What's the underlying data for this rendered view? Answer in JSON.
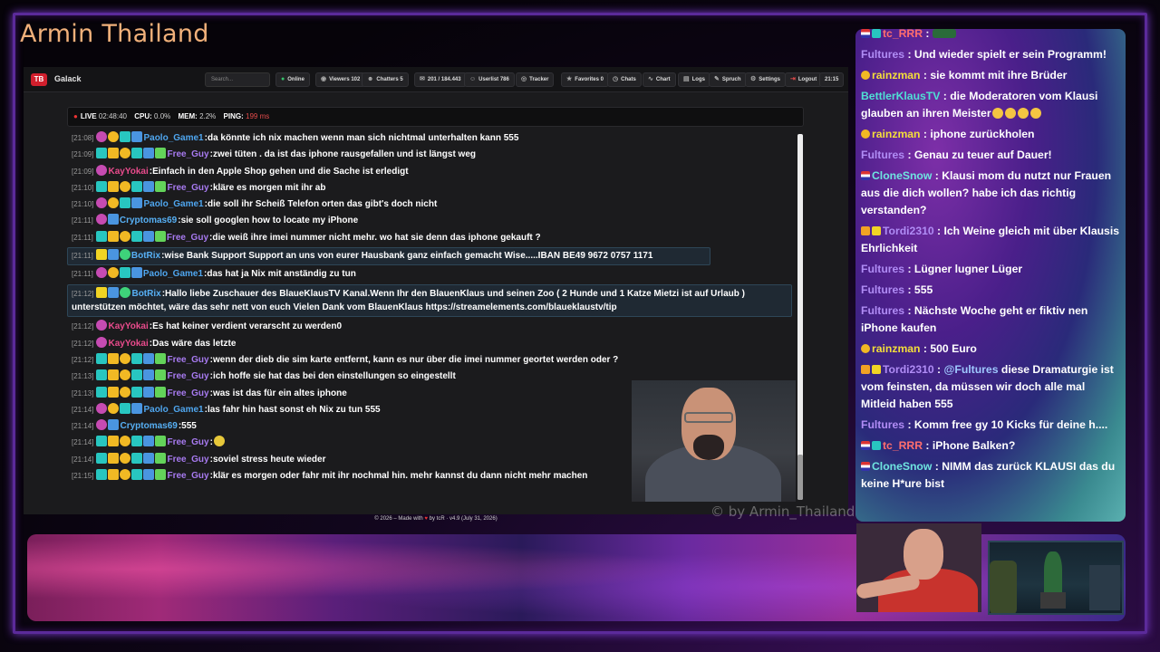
{
  "stream_title": "Armin Thailand",
  "app": {
    "logo_text": "TB",
    "brand": "Galack",
    "search_placeholder": "Search...",
    "toolbar": [
      {
        "icon": "●",
        "label": "Online",
        "name": "online-button"
      },
      {
        "icon": "◉",
        "label": "Viewers 102",
        "name": "viewers-button"
      },
      {
        "icon": "☻",
        "label": "Chatters 5",
        "name": "chatters-button"
      },
      {
        "icon": "✉",
        "label": "201 / 184.443",
        "name": "messages-button"
      },
      {
        "icon": "☺",
        "label": "Userlist 786",
        "name": "userlist-button"
      },
      {
        "icon": "◎",
        "label": "Tracker",
        "name": "tracker-button"
      },
      {
        "icon": "★",
        "label": "Favorites 0",
        "name": "favorites-button"
      },
      {
        "icon": "◷",
        "label": "Chats",
        "name": "chats-button"
      },
      {
        "icon": "∿",
        "label": "Chart",
        "name": "chart-button"
      },
      {
        "icon": "▤",
        "label": "Logs",
        "name": "logs-button"
      },
      {
        "icon": "✎",
        "label": "Spruch",
        "name": "spruch-button"
      },
      {
        "icon": "⚙",
        "label": "Settings",
        "name": "settings-button"
      },
      {
        "icon": "⇥",
        "label": "Logout",
        "name": "logout-button"
      }
    ],
    "clock": "21:15",
    "status": {
      "live_label": "LIVE",
      "live_time": "02:48:40",
      "cpu_label": "CPU:",
      "cpu_value": "0.0%",
      "mem_label": "MEM:",
      "mem_value": "2.2%",
      "ping_label": "PING:",
      "ping_value": "199 ms"
    },
    "footer": {
      "prefix": "© 2026 – Made with",
      "heart": "♥",
      "suffix": "by tcR · v4.9 (July 31, 2026)"
    }
  },
  "chat_rows": [
    {
      "time": "[21:08]",
      "badges": [
        "pink",
        "one",
        "teal",
        "blue"
      ],
      "user": "Paolo_Game1",
      "ucls": "u-blue",
      "text": "da könnte ich nix machen wenn man sich nichtmal unterhalten kann 555"
    },
    {
      "time": "[21:09]",
      "badges": [
        "teal",
        "crown",
        "one",
        "teal",
        "blue",
        "gift"
      ],
      "user": "Free_Guy",
      "ucls": "u-purple",
      "text": "zwei tüten . da ist das iphone rausgefallen und ist längst weg"
    },
    {
      "time": "[21:09]",
      "badges": [
        "pink"
      ],
      "user": "KayYokai",
      "ucls": "u-pink",
      "text": "Einfach in den Apple Shop gehen und die Sache ist erledigt"
    },
    {
      "time": "[21:10]",
      "badges": [
        "teal",
        "crown",
        "one",
        "teal",
        "blue",
        "gift"
      ],
      "user": "Free_Guy",
      "ucls": "u-purple",
      "text": "kläre es morgen mit ihr ab"
    },
    {
      "time": "[21:10]",
      "badges": [
        "pink",
        "one",
        "teal",
        "blue"
      ],
      "user": "Paolo_Game1",
      "ucls": "u-blue",
      "text": "die soll ihr Scheiß Telefon orten das gibt's doch nicht"
    },
    {
      "time": "[21:11]",
      "badges": [
        "pink",
        "blue"
      ],
      "user": "Cryptomas69",
      "ucls": "u-lblue",
      "text": "sie soll googlen how to locate my iPhone"
    },
    {
      "time": "[21:11]",
      "badges": [
        "teal",
        "crown",
        "one",
        "teal",
        "blue",
        "gift"
      ],
      "user": "Free_Guy",
      "ucls": "u-purple",
      "text": "die weiß ihre imei nummer nicht mehr. wo hat sie denn das iphone gekauft ?"
    },
    {
      "time": "[21:11]",
      "badges": [
        "yel",
        "blue",
        "green"
      ],
      "user": "BotRix",
      "ucls": "u-lblue",
      "text": "wise Bank Support Support an uns von eurer Hausbank ganz einfach gemacht Wise.....IBAN BE49 9672 0757 1171",
      "hl": "hl"
    },
    {
      "time": "[21:11]",
      "badges": [
        "pink",
        "one",
        "teal",
        "blue"
      ],
      "user": "Paolo_Game1",
      "ucls": "u-blue",
      "text": "das hat ja Nix mit anständig zu tun"
    },
    {
      "time": "[21:12]",
      "badges": [
        "yel",
        "blue",
        "green"
      ],
      "user": "BotRix",
      "ucls": "u-lblue",
      "text": "Hallo liebe Zuschauer des BlaueKlausTV Kanal.Wenn Ihr den BlauenKlaus und seinen Zoo ( 2 Hunde und 1 Katze Mietzi ist auf Urlaub ) unterstützen möchtet, wäre das sehr nett von euch Vielen Dank vom BlauenKlaus https://streamelements.com/blaueklaustv/tip",
      "hl": "hl2"
    },
    {
      "time": "[21:12]",
      "badges": [
        "pink"
      ],
      "user": "KayYokai",
      "ucls": "u-pink",
      "text": "Es hat keiner verdient verarscht zu werden0"
    },
    {
      "time": "[21:12]",
      "badges": [
        "pink"
      ],
      "user": "KayYokai",
      "ucls": "u-pink",
      "text": "Das wäre das letzte"
    },
    {
      "time": "[21:12]",
      "badges": [
        "teal",
        "crown",
        "one",
        "teal",
        "blue",
        "gift"
      ],
      "user": "Free_Guy",
      "ucls": "u-purple",
      "text": "wenn der dieb die sim karte entfernt, kann es nur über die imei nummer geortet werden oder ?"
    },
    {
      "time": "[21:13]",
      "badges": [
        "teal",
        "crown",
        "one",
        "teal",
        "blue",
        "gift"
      ],
      "user": "Free_Guy",
      "ucls": "u-purple",
      "text": "ich hoffe sie hat das bei den einstellungen so eingestellt"
    },
    {
      "time": "[21:13]",
      "badges": [
        "teal",
        "crown",
        "one",
        "teal",
        "blue",
        "gift"
      ],
      "user": "Free_Guy",
      "ucls": "u-purple",
      "text": "was ist das für ein altes iphone"
    },
    {
      "time": "[21:14]",
      "badges": [
        "pink",
        "one",
        "teal",
        "blue"
      ],
      "user": "Paolo_Game1",
      "ucls": "u-blue",
      "text": "las fahr hin hast sonst eh Nix zu tun 555"
    },
    {
      "time": "[21:14]",
      "badges": [
        "pink",
        "blue"
      ],
      "user": "Cryptomas69",
      "ucls": "u-lblue",
      "text": "555"
    },
    {
      "time": "[21:14]",
      "badges": [
        "teal",
        "crown",
        "one",
        "teal",
        "blue",
        "gift"
      ],
      "user": "Free_Guy",
      "ucls": "u-purple",
      "text": ""
    },
    {
      "time": "[21:14]",
      "badges": [
        "teal",
        "crown",
        "one",
        "teal",
        "blue",
        "gift"
      ],
      "user": "Free_Guy",
      "ucls": "u-purple",
      "text": "soviel stress heute wieder"
    },
    {
      "time": "[21:15]",
      "badges": [
        "teal",
        "crown",
        "one",
        "teal",
        "blue",
        "gift"
      ],
      "user": "Free_Guy",
      "ucls": "u-purple",
      "text": "klär es morgen oder fahr mit ihr nochmal hin. mehr kannst du dann nicht mehr machen"
    }
  ],
  "watermark": "© by Armin_Thailand",
  "right_chat": [
    {
      "badges": [
        "flag",
        "teal"
      ],
      "user": "tc_RRR",
      "ucls": "rn-red",
      "text": "",
      "gif": true
    },
    {
      "badges": [],
      "user": "Fultures",
      "ucls": "rn-pur",
      "text": "Und wieder spielt er sein Programm!"
    },
    {
      "badges": [
        "one"
      ],
      "user": "rainzman",
      "ucls": "rn-yel",
      "text": "sie kommt mit ihre Brüder"
    },
    {
      "badges": [],
      "user": "BettlerKlausTV",
      "ucls": "rn-cyan",
      "text": "die Moderatoren vom Klausi glauben an ihren Meister",
      "emotes": 4
    },
    {
      "badges": [
        "one"
      ],
      "user": "rainzman",
      "ucls": "rn-yel",
      "text": "iphone zurückholen"
    },
    {
      "badges": [],
      "user": "Fultures",
      "ucls": "rn-pur",
      "text": "Genau zu teuer auf Dauer!"
    },
    {
      "badges": [
        "flag"
      ],
      "user": "CloneSnow",
      "ucls": "rn-teal",
      "text": "Klausi mom du nutzt nur Frauen aus die dich wollen? habe ich das richtig verstanden?"
    },
    {
      "badges": [
        "gold",
        "crown"
      ],
      "user": "Tordi2310",
      "ucls": "rn-pur",
      "text": "Ich Weine gleich mit über Klausis Ehrlichkeit"
    },
    {
      "badges": [],
      "user": "Fultures",
      "ucls": "rn-pur",
      "text": "Lügner lugner Lüger"
    },
    {
      "badges": [],
      "user": "Fultures",
      "ucls": "rn-pur",
      "text": "555"
    },
    {
      "badges": [],
      "user": "Fultures",
      "ucls": "rn-pur",
      "text": "Nächste Woche geht er fiktiv nen iPhone kaufen"
    },
    {
      "badges": [
        "one"
      ],
      "user": "rainzman",
      "ucls": "rn-yel",
      "text": "500 Euro"
    },
    {
      "badges": [
        "gold",
        "crown"
      ],
      "user": "Tordi2310",
      "ucls": "rn-pur",
      "mention": "@Fultures",
      "text": "diese Dramaturgie ist vom feinsten, da müssen wir doch alle mal Mitleid haben 555"
    },
    {
      "badges": [],
      "user": "Fultures",
      "ucls": "rn-pur",
      "text": "Komm free gy 10 Kicks für deine h...."
    },
    {
      "badges": [
        "flag",
        "teal"
      ],
      "user": "tc_RRR",
      "ucls": "rn-red",
      "text": "iPhone Balken?"
    },
    {
      "badges": [
        "flag"
      ],
      "user": "CloneSnow",
      "ucls": "rn-teal",
      "text": "NIMM das zurück KLAUSI das du keine H*ure bist"
    }
  ],
  "colors": {
    "accent": "#5b2a9a",
    "title": "#f0b07a",
    "live": "#e33333",
    "online": "#35c26b"
  }
}
